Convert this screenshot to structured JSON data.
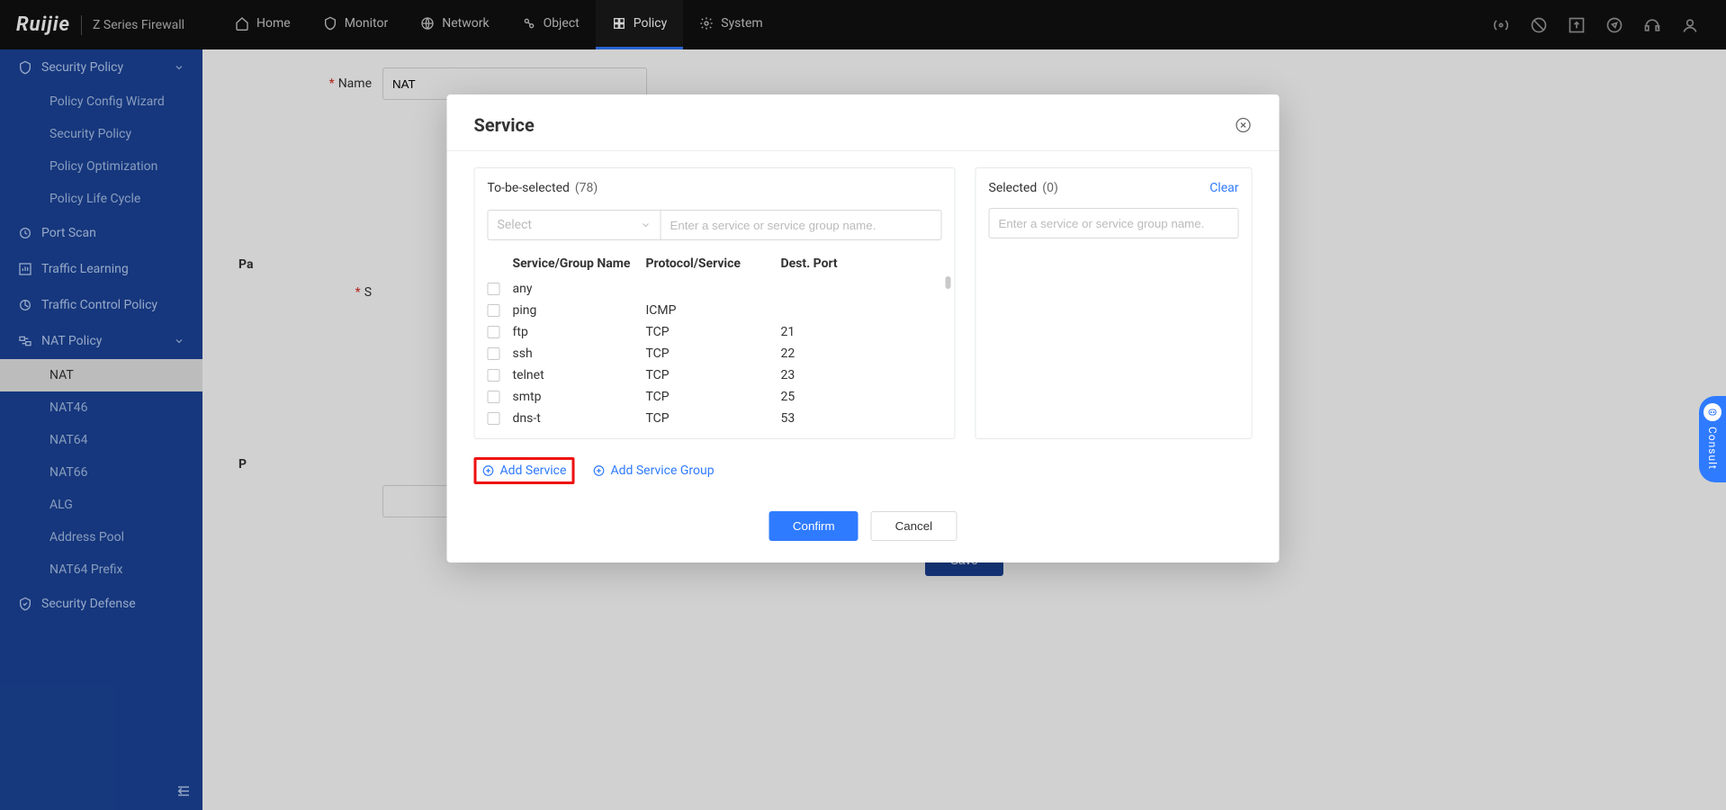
{
  "brand": {
    "name": "Ruijie",
    "series": "Z Series Firewall"
  },
  "topnav": [
    {
      "label": "Home"
    },
    {
      "label": "Monitor"
    },
    {
      "label": "Network"
    },
    {
      "label": "Object"
    },
    {
      "label": "Policy",
      "active": true
    },
    {
      "label": "System"
    }
  ],
  "sidebar": {
    "groups": [
      {
        "label": "Security Policy",
        "expandable": true,
        "items": [
          {
            "label": "Policy Config Wizard"
          },
          {
            "label": "Security Policy"
          },
          {
            "label": "Policy Optimization"
          },
          {
            "label": "Policy Life Cycle"
          }
        ]
      },
      {
        "label": "Port Scan"
      },
      {
        "label": "Traffic Learning"
      },
      {
        "label": "Traffic Control Policy"
      },
      {
        "label": "NAT Policy",
        "expandable": true,
        "items": [
          {
            "label": "NAT",
            "active": true
          },
          {
            "label": "NAT46"
          },
          {
            "label": "NAT64"
          },
          {
            "label": "NAT66"
          },
          {
            "label": "ALG"
          },
          {
            "label": "Address Pool"
          },
          {
            "label": "NAT64 Prefix"
          }
        ]
      },
      {
        "label": "Security Defense"
      }
    ]
  },
  "main_form": {
    "name_label": "Name",
    "name_value": "NAT",
    "section_pa": "Pa",
    "s_label": "S",
    "section_p": "P",
    "save": "Save"
  },
  "modal": {
    "title": "Service",
    "to_be_selected": "To-be-selected",
    "to_count": "(78)",
    "selected": "Selected",
    "sel_count": "(0)",
    "clear": "Clear",
    "select_placeholder": "Select",
    "search_placeholder": "Enter a service or service group name.",
    "columns": {
      "name": "Service/Group Name",
      "proto": "Protocol/Service",
      "port": "Dest. Port"
    },
    "rows": [
      {
        "name": "any",
        "proto": "",
        "port": ""
      },
      {
        "name": "ping",
        "proto": "ICMP",
        "port": ""
      },
      {
        "name": "ftp",
        "proto": "TCP",
        "port": "21"
      },
      {
        "name": "ssh",
        "proto": "TCP",
        "port": "22"
      },
      {
        "name": "telnet",
        "proto": "TCP",
        "port": "23"
      },
      {
        "name": "smtp",
        "proto": "TCP",
        "port": "25"
      },
      {
        "name": "dns-t",
        "proto": "TCP",
        "port": "53"
      }
    ],
    "add_service": "Add Service",
    "add_group": "Add Service Group",
    "confirm": "Confirm",
    "cancel": "Cancel"
  },
  "consult": {
    "label": "Consult"
  }
}
